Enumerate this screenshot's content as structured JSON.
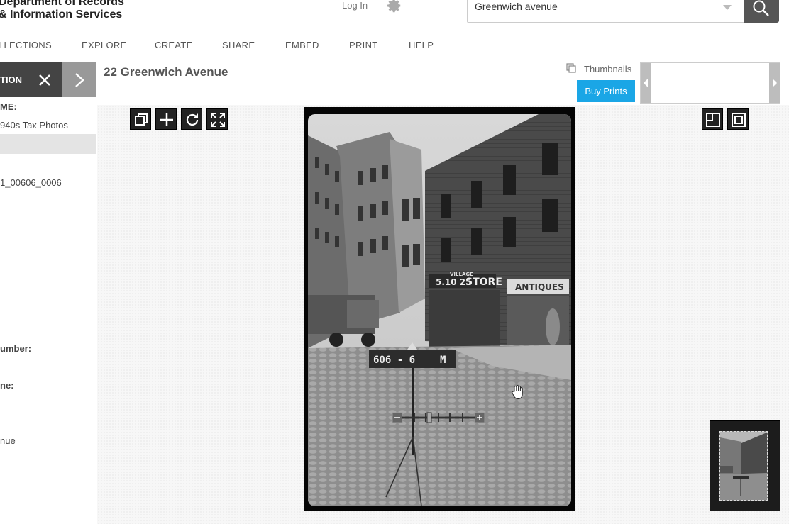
{
  "header": {
    "logo_line1": "Department of Records",
    "logo_line2": "& Information Services",
    "login_label": "Log In",
    "search_value": "Greenwich avenue"
  },
  "nav": {
    "items": [
      "LLECTIONS",
      "EXPLORE",
      "CREATE",
      "SHARE",
      "EMBED",
      "PRINT",
      "HELP"
    ]
  },
  "sidebar": {
    "header_label": "TION",
    "label_1": "ME:",
    "value_1": "940s Tax Photos",
    "value_2": "1_00606_0006",
    "label_2": "umber:",
    "label_3": "ne:",
    "value_3": "nue"
  },
  "main": {
    "title": "22 Greenwich Avenue",
    "thumbnails_label": "Thumbnails",
    "buy_prints_label": "Buy Prints"
  },
  "photo": {
    "sign_number": "606 - 6",
    "sign_letter": "M",
    "store_sign": "STORE",
    "store_prices": "5.10 25",
    "village_label": "VILLAGE",
    "antiques_sign": "ANTIQUES"
  },
  "colors": {
    "accent": "#1aa6e6",
    "dark_panel": "#444444",
    "tool_bg": "#222222"
  }
}
